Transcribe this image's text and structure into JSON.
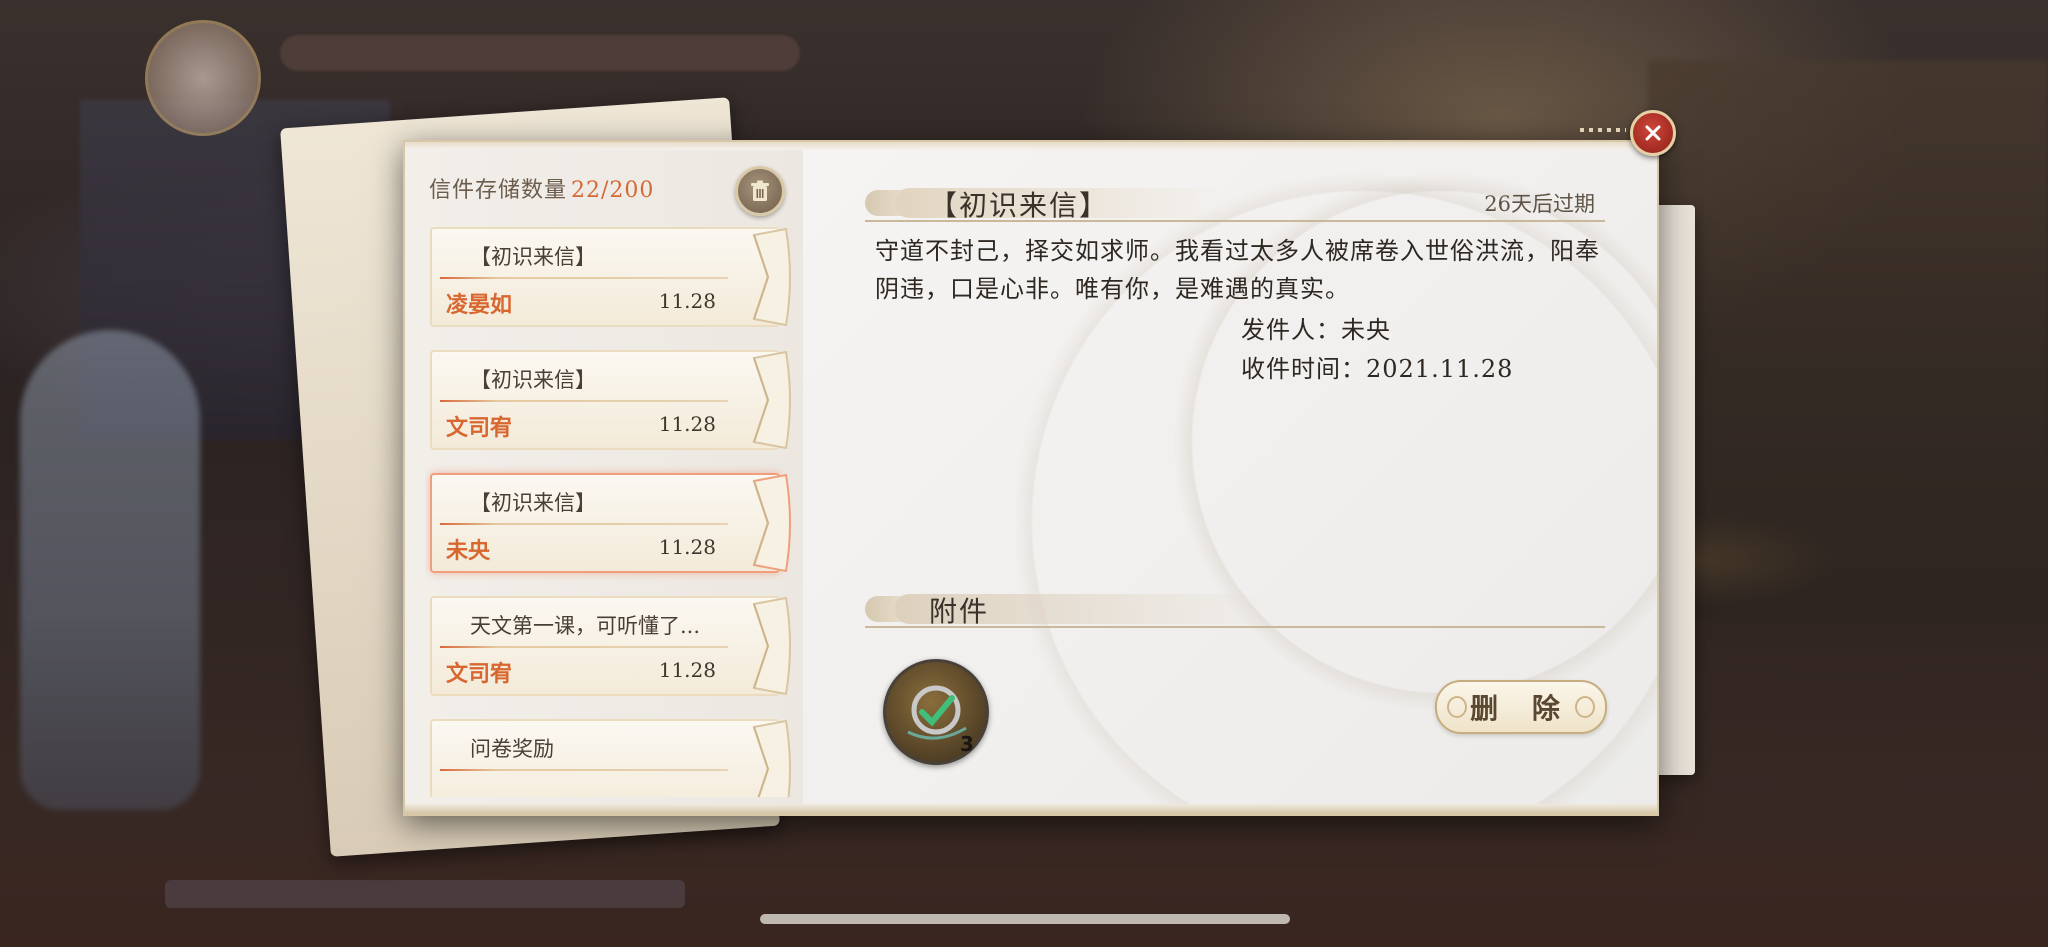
{
  "storage": {
    "label": "信件存储数量",
    "count": "22/200"
  },
  "mails": [
    {
      "title": "【初识来信】",
      "sender": "凌晏如",
      "date": "11.28",
      "selected": false
    },
    {
      "title": "【初识来信】",
      "sender": "文司宥",
      "date": "11.28",
      "selected": false
    },
    {
      "title": "【初识来信】",
      "sender": "未央",
      "date": "11.28",
      "selected": true
    },
    {
      "title": "天文第一课，可听懂了...",
      "sender": "文司宥",
      "date": "11.28",
      "selected": false
    },
    {
      "title": "问卷奖励",
      "sender": "",
      "date": "",
      "selected": false
    }
  ],
  "letter": {
    "title": "【初识来信】",
    "expire": "26天后过期",
    "body": "守道不封己，择交如求师。我看过太多人被席卷入世俗洪流，阳奉阴违，口是心非。唯有你，是难遇的真实。",
    "sender_line": "发件人：未央",
    "time_line": "收件时间：2021.11.28"
  },
  "attachments": {
    "label": "附件",
    "items": [
      {
        "icon": "compass-medal-icon",
        "count": "3"
      }
    ]
  },
  "buttons": {
    "delete": "删 除"
  },
  "colors": {
    "accent": "#d8662f",
    "selected_border": "#ef9f7d",
    "close_red": "#b8342a"
  }
}
